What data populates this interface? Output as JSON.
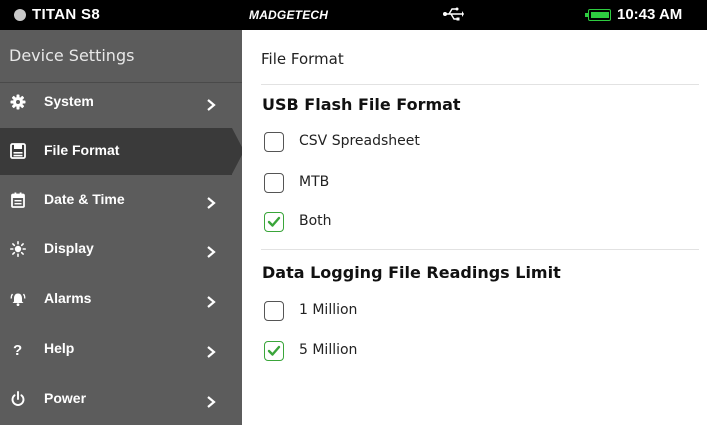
{
  "status_bar": {
    "device_name": "TITAN S8",
    "brand": "MADGETECH",
    "time": "10:43 AM",
    "battery_color": "#2ecc40"
  },
  "sidebar": {
    "title": "Device Settings",
    "items": [
      {
        "label": "System",
        "icon": "gear-icon",
        "has_chevron": true,
        "active": false
      },
      {
        "label": "File Format",
        "icon": "save-icon",
        "has_chevron": false,
        "active": true
      },
      {
        "label": "Date & Time",
        "icon": "calendar-icon",
        "has_chevron": true,
        "active": false
      },
      {
        "label": "Display",
        "icon": "brightness-icon",
        "has_chevron": true,
        "active": false
      },
      {
        "label": "Alarms",
        "icon": "alarm-icon",
        "has_chevron": true,
        "active": false
      },
      {
        "label": "Help",
        "icon": "help-icon",
        "has_chevron": true,
        "active": false
      },
      {
        "label": "Power",
        "icon": "power-icon",
        "has_chevron": true,
        "active": false
      }
    ]
  },
  "main": {
    "page_title": "File Format",
    "usb_section": {
      "title": "USB Flash File Format",
      "options": [
        {
          "label": "CSV Spreadsheet",
          "checked": false
        },
        {
          "label": "MTB",
          "checked": false
        },
        {
          "label": "Both",
          "checked": true
        }
      ]
    },
    "limit_section": {
      "title": "Data Logging File Readings Limit",
      "options": [
        {
          "label": "1 Million",
          "checked": false
        },
        {
          "label": "5 Million",
          "checked": true
        }
      ]
    }
  },
  "colors": {
    "sidebar_bg": "#5c5c5c",
    "active_bg": "#3a3a3a",
    "check_green": "#3aa53a"
  }
}
